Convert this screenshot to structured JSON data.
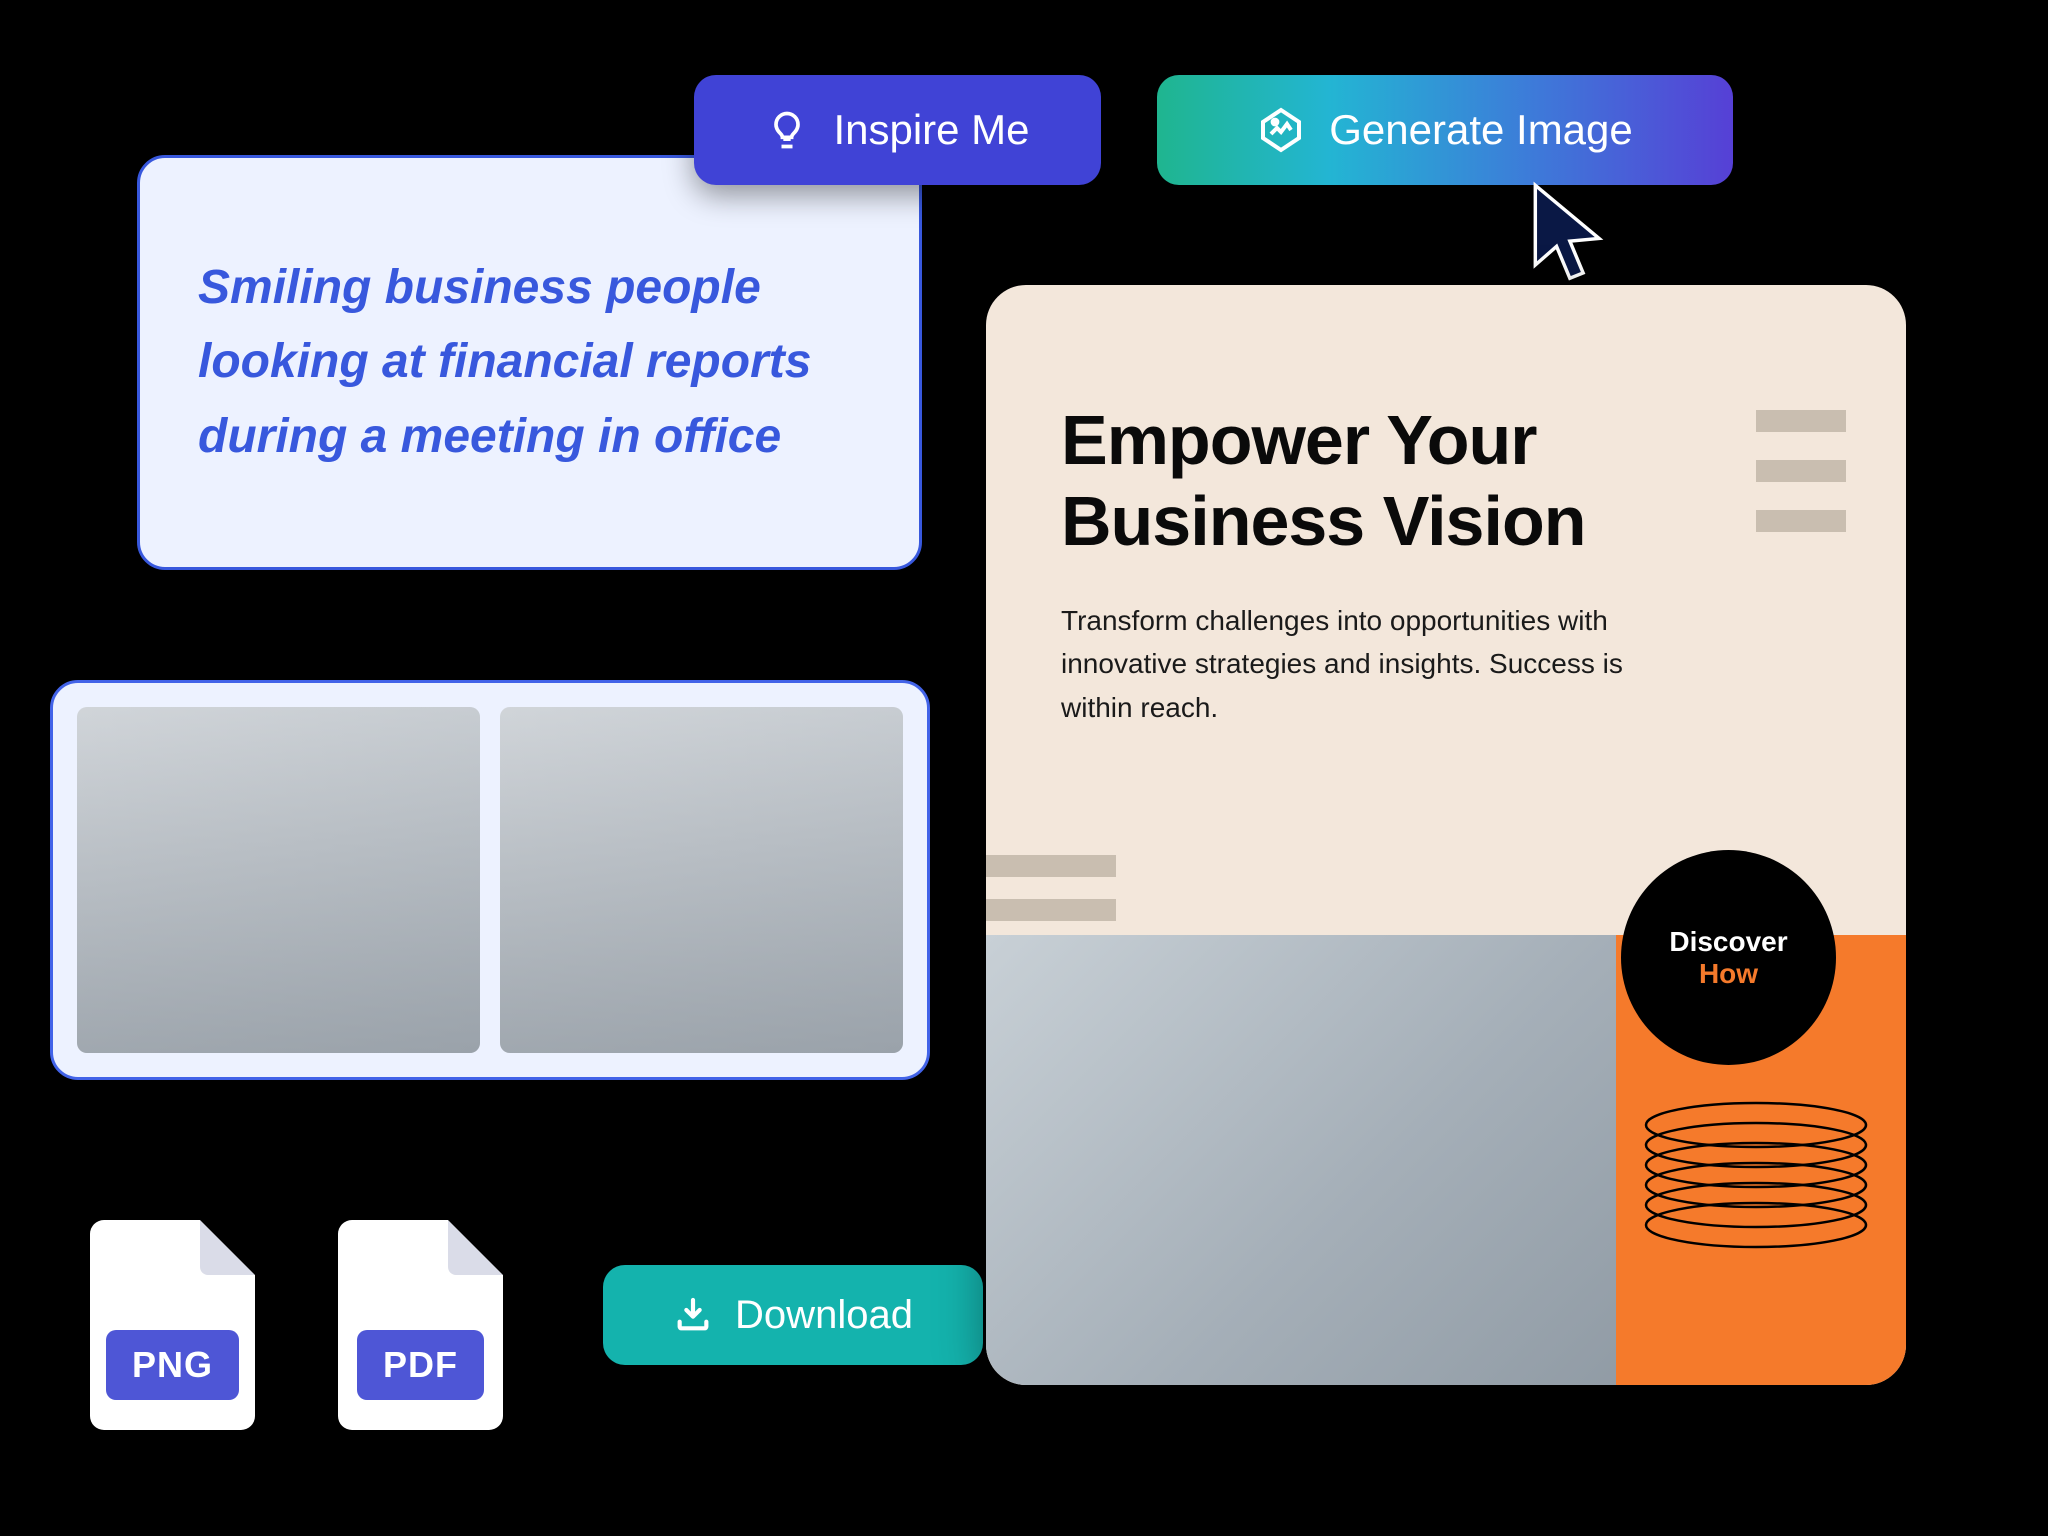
{
  "prompt": {
    "text": "Smiling business people looking at financial reports during a meeting in office"
  },
  "buttons": {
    "inspire_label": "Inspire Me",
    "generate_label": "Generate Image",
    "download_label": "Download"
  },
  "files": {
    "png_label": "PNG",
    "pdf_label": "PDF"
  },
  "design": {
    "title": "Empower Your Business Vision",
    "subtitle": "Transform challenges into opportunities with innovative strategies and insights. Success is within reach.",
    "cta_line1": "Discover",
    "cta_line2": "How"
  }
}
